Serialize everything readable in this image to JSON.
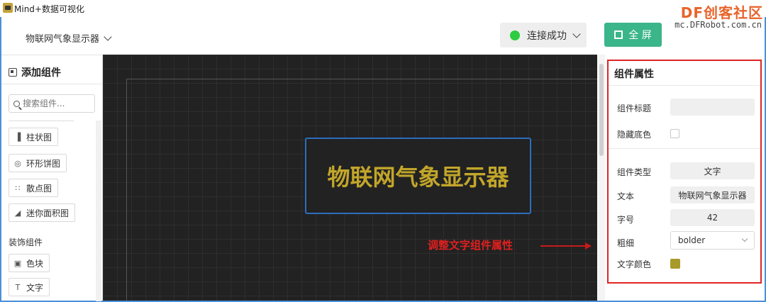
{
  "window": {
    "title": "Mind+数据可视化"
  },
  "watermark": {
    "brand": "DF创客社区",
    "url": "mc.DFRobot.com.cn"
  },
  "header": {
    "project_name": "物联网气象显示器",
    "connection_status": "连接成功",
    "fullscreen_label": "全 屏"
  },
  "left_panel": {
    "title": "添加组件",
    "search_placeholder": "搜索组件...",
    "components": [
      {
        "label": "柱状图",
        "icon": "bar-chart-icon"
      },
      {
        "label": "环形饼图",
        "icon": "donut-chart-icon"
      },
      {
        "label": "散点图",
        "icon": "scatter-icon"
      },
      {
        "label": "迷你面积图",
        "icon": "area-chart-icon"
      }
    ],
    "deco_section_title": "装饰组件",
    "deco_components": [
      {
        "label": "色块",
        "icon": "color-block-icon"
      },
      {
        "label": "文字",
        "icon": "text-icon"
      }
    ]
  },
  "canvas": {
    "widget_text": "物联网气象显示器",
    "widget_text_color": "#c2a62a",
    "annotation": "调整文字组件属性"
  },
  "properties": {
    "title": "组件属性",
    "component_title_label": "组件标题",
    "component_title_value": "",
    "hide_bg_label": "隐藏底色",
    "hide_bg_checked": false,
    "type_label": "组件类型",
    "type_value": "文字",
    "text_label": "文本",
    "text_value": "物联网气象显示器",
    "font_size_label": "字号",
    "font_size_value": "42",
    "weight_label": "粗细",
    "weight_value": "bolder",
    "color_label": "文字颜色",
    "color_value": "#a89a2a"
  },
  "colors": {
    "accent_green": "#3bb58a",
    "status_green": "#2ecc40",
    "annotation_red": "#e0201f"
  }
}
